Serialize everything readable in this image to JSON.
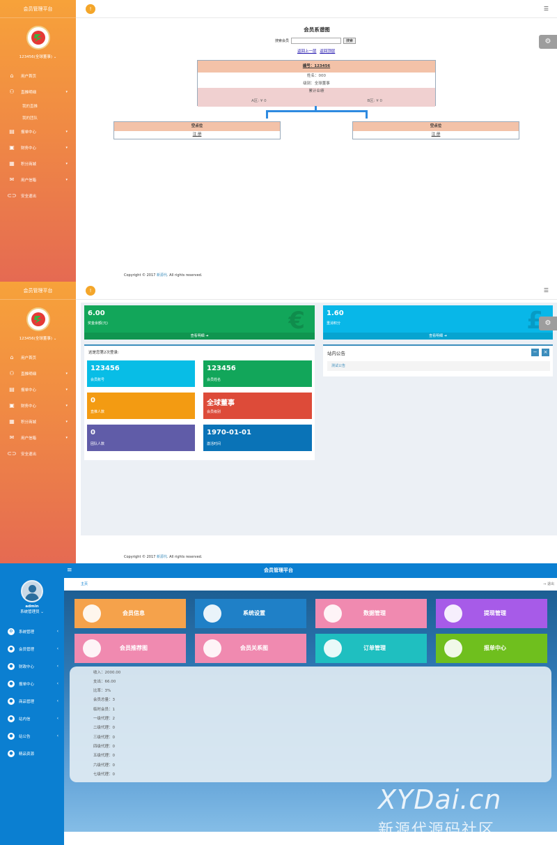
{
  "panel1": {
    "platform_title": "会员管理平台",
    "user_label": "123456(全球董事) ⌄",
    "topbar_badge": "!",
    "nav": [
      {
        "label": "用户首页",
        "icon": "home-icon",
        "caret": ""
      },
      {
        "label": "直推明细",
        "icon": "users-icon",
        "caret": "▾"
      },
      {
        "label": "报单中心",
        "icon": "file-icon",
        "caret": "▾"
      },
      {
        "label": "财务中心",
        "icon": "money-icon",
        "caret": "▾"
      },
      {
        "label": "积分商城",
        "icon": "cart-icon",
        "caret": "▾"
      },
      {
        "label": "用户信箱",
        "icon": "mail-icon",
        "caret": "▾"
      },
      {
        "label": "安全退出",
        "icon": "exit-icon",
        "caret": ""
      }
    ],
    "subnav": [
      "我的直推",
      "我的团队"
    ],
    "tree": {
      "title": "会员系谱图",
      "search_label": "搜索会员",
      "search_value": "",
      "search_button": "搜索",
      "link_up": "返回上一层",
      "link_top": "返回顶层",
      "node": {
        "id": "编号：123456",
        "name": "姓名：000",
        "level": "级别：全球董事",
        "perf": "累计业绩",
        "a_zone": "A区: ¥ 0",
        "b_zone": "B区: ¥ 0"
      },
      "children": [
        {
          "head": "空点位",
          "action": "注 册"
        },
        {
          "head": "空点位",
          "action": "注 册"
        }
      ]
    },
    "footer_prefix": "Copyright © 2017 ",
    "footer_link": "新源代",
    "footer_suffix": ". All rights reserved."
  },
  "panel2": {
    "platform_title": "会员管理平台",
    "user_label": "123456(全球董事) ⌄",
    "topbar_badge": "!",
    "nav": [
      "用户首页",
      "直推明细",
      "报单中心",
      "财务中心",
      "积分商城",
      "用户信箱",
      "安全退出"
    ],
    "boxes": [
      {
        "value": "6.00",
        "label": "奖金余额(元)",
        "symbol": "€",
        "more": "查看明细 ➜",
        "color": "#12a65a"
      },
      {
        "value": "1.60",
        "label": "重消积分",
        "symbol": "£",
        "more": "查看明细 ➜",
        "color": "#08b7e8"
      }
    ],
    "login_text": "这是您第2次登录:",
    "tiles": [
      {
        "value": "123456",
        "label": "会员账号",
        "color": "#08bde6"
      },
      {
        "value": "123456",
        "label": "会员姓名",
        "color": "#12a65a"
      },
      {
        "value": "0",
        "label": "直推人数",
        "color": "#f39b12"
      },
      {
        "value": "全球董事",
        "label": "会员级别",
        "color": "#dd4b39"
      },
      {
        "value": "0",
        "label": "团队人数",
        "color": "#605ca8"
      },
      {
        "value": "1970-01-01",
        "label": "激活时间",
        "color": "#0a73b7"
      }
    ],
    "notice_title": "站内公告",
    "notice_item": "测试公告",
    "notice_minus": "−",
    "notice_close": "×",
    "footer_prefix": "Copyright © 2017 ",
    "footer_link": "新源代",
    "footer_suffix": ". All rights reserved."
  },
  "panel3": {
    "title": "会员管理平台",
    "admin_name": "admin",
    "admin_role": "系统管理员 ⌄",
    "nav": [
      {
        "label": "系统管理",
        "icon": "gear-icon"
      },
      {
        "label": "会员管理",
        "icon": "user-icon"
      },
      {
        "label": "财政中心",
        "icon": "money-icon"
      },
      {
        "label": "报单中心",
        "icon": "file-icon"
      },
      {
        "label": "商品管理",
        "icon": "box-icon"
      },
      {
        "label": "站内信",
        "icon": "mail-icon"
      },
      {
        "label": "站公告",
        "icon": "bell-icon"
      },
      {
        "label": "精品资源",
        "icon": "star-icon"
      }
    ],
    "breadcrumb_home": "主页",
    "logout": "⇒ 退出",
    "tiles": [
      {
        "label": "会员信息",
        "color": "#f5a24b",
        "icon": "users-icon"
      },
      {
        "label": "系统设置",
        "color": "#1f80c7",
        "icon": "gear-icon"
      },
      {
        "label": "数据管理",
        "color": "#f08ab0",
        "icon": "database-icon"
      },
      {
        "label": "提现管理",
        "color": "#a75be8",
        "icon": "user-icon"
      },
      {
        "label": "会员推荐图",
        "color": "#f08ab0",
        "icon": "user-icon"
      },
      {
        "label": "会员关系图",
        "color": "#f08ab0",
        "icon": "users-icon"
      },
      {
        "label": "订单管理",
        "color": "#1fbfc0",
        "icon": "user-icon"
      },
      {
        "label": "报单中心",
        "color": "#6fbf1e",
        "icon": "doc-icon"
      }
    ],
    "stats": [
      "收入：2000.00",
      "支出：66.00",
      "比率：3%",
      "会员总量：3",
      "临时会员：1",
      "一级代理：2",
      "二级代理：0",
      "三级代理：0",
      "四级代理：0",
      "五级代理：0",
      "六级代理：0",
      "七级代理：0"
    ],
    "watermark_1": "XYDai.cn",
    "watermark_2": "新源代源码社区"
  },
  "colors": {
    "sidebar_orange": "#f7a23a",
    "admin_blue": "#0b7fd1",
    "accent": "#3c8dbc"
  }
}
